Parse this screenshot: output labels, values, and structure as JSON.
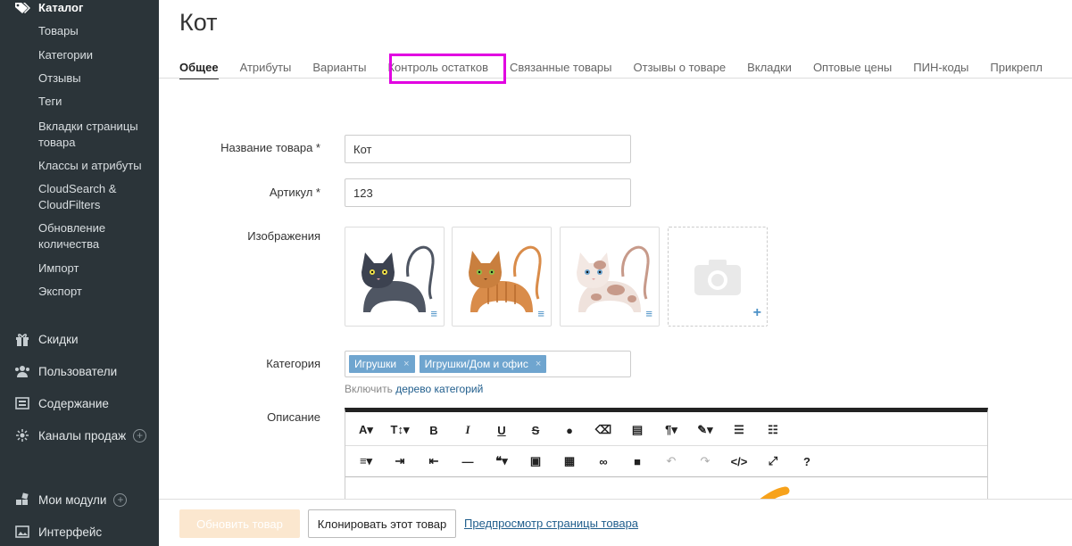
{
  "sidebar": {
    "catalog_header": "Каталог",
    "catalog_items": [
      {
        "label": "Товары"
      },
      {
        "label": "Категории"
      },
      {
        "label": "Отзывы"
      },
      {
        "label": "Теги"
      },
      {
        "label": "Вкладки страницы товара"
      },
      {
        "label": "Классы и атрибуты"
      },
      {
        "label": "CloudSearch & CloudFilters"
      },
      {
        "label": "Обновление количества"
      },
      {
        "label": "Импорт"
      },
      {
        "label": "Экспорт"
      }
    ],
    "main_items": [
      {
        "label": "Скидки",
        "icon": "gift-icon"
      },
      {
        "label": "Пользователи",
        "icon": "users-icon"
      },
      {
        "label": "Содержание",
        "icon": "content-icon"
      },
      {
        "label": "Каналы продаж",
        "icon": "channels-icon"
      },
      {
        "label": "Мои модули",
        "icon": "modules-icon"
      },
      {
        "label": "Интерфейс",
        "icon": "interface-icon"
      }
    ]
  },
  "page": {
    "title": "Кот"
  },
  "tabs": [
    {
      "label": "Общее",
      "active": true
    },
    {
      "label": "Атрибуты"
    },
    {
      "label": "Варианты"
    },
    {
      "label": "Контроль остатков",
      "highlighted": true
    },
    {
      "label": "Связанные товары"
    },
    {
      "label": "Отзывы о товаре"
    },
    {
      "label": "Вкладки"
    },
    {
      "label": "Оптовые цены"
    },
    {
      "label": "ПИН-коды"
    },
    {
      "label": "Прикрепл"
    }
  ],
  "form": {
    "name_label": "Название товара *",
    "name_value": "Кот",
    "sku_label": "Артикул *",
    "sku_value": "123",
    "images_label": "Изображения",
    "images": [
      {
        "alt": "Серый кот",
        "body": "#4f5663",
        "accent": "#3c4250"
      },
      {
        "alt": "Рыжий полосатый кот",
        "body": "#d98c4a",
        "accent": "#b86b2c"
      },
      {
        "alt": "Пятнистый кот",
        "body": "#efe2dc",
        "accent": "#c79a8a"
      }
    ],
    "category_label": "Категория",
    "categories": [
      "Игрушки",
      "Игрушки/Дом и офис"
    ],
    "category_hint_prefix": "Включить",
    "category_hint_link": "дерево категорий",
    "description_label": "Описание"
  },
  "editor": {
    "row1": [
      "A▾",
      "T↕▾",
      "B",
      "I",
      "U",
      "S",
      "drop-icon",
      "eraser-icon",
      "print-icon",
      "¶▾",
      "wand-icon▾",
      "ordered-list-icon",
      "unordered-list-icon"
    ],
    "row2": [
      "align-icon▾",
      "indent-icon",
      "outdent-icon",
      "hr-icon",
      "quote-icon▾",
      "image-icon",
      "table-icon",
      "link-icon",
      "video-icon",
      "undo-icon",
      "redo-icon",
      "code-icon",
      "fullscreen-icon",
      "help-icon"
    ]
  },
  "actions": {
    "update_label": "Обновить товар",
    "clone_label": "Клонировать этот товар",
    "preview_label": "Предпросмотр страницы товара"
  },
  "colors": {
    "sidebar_bg": "#2b3439",
    "highlight": "#e100e1",
    "tag_bg": "#6fa5cf",
    "link": "#1f5d8c",
    "update_button_bg": "#fbe7cf"
  }
}
